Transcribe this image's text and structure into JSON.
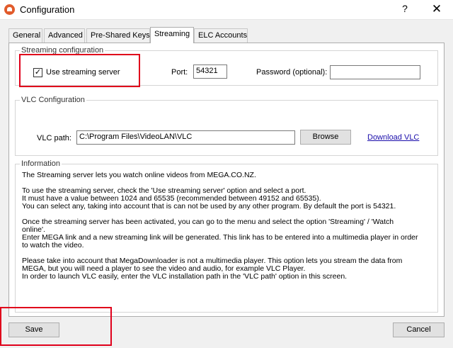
{
  "window": {
    "title": "Configuration",
    "help_glyph": "?",
    "close_glyph": "✕"
  },
  "tabs": [
    {
      "label": "General"
    },
    {
      "label": "Advanced"
    },
    {
      "label": "Pre-Shared Keys"
    },
    {
      "label": "Streaming",
      "active": true
    },
    {
      "label": "ELC Accounts"
    }
  ],
  "streaming": {
    "legend": "Streaming configuration",
    "use_server_label": "Use streaming server",
    "use_server_checked": true,
    "checkmark": "✓",
    "port_label": "Port:",
    "port_value": "54321",
    "password_label": "Password (optional):",
    "password_value": ""
  },
  "vlc": {
    "legend": "VLC Configuration",
    "path_label": "VLC path:",
    "path_value": "C:\\Program Files\\VideoLAN\\VLC",
    "browse_label": "Browse",
    "download_link": "Download VLC"
  },
  "information": {
    "legend": "Information",
    "lines": [
      "The Streaming server lets you watch online videos from MEGA.CO.NZ.",
      "",
      "To use the streaming server, check the 'Use streaming server' option and select a port.",
      "It must have a value between 1024 and 65535 (recommended between 49152 and 65535).",
      "You can select any, taking into account that is can not be used by any other program. By default the port is 54321.",
      "",
      "Once the streaming server has been activated, you can go to the menu and select the option 'Streaming' / 'Watch",
      "online'.",
      "Enter MEGA link and a new streaming link will be generated. This link has to be entered into a multimedia player in order",
      "to watch the video.",
      "",
      "Please take into account that MegaDownloader is not a multimedia player. This option lets you stream the data from",
      "MEGA, but you will need a player to see the video and audio, for example VLC Player.",
      "In order to launch VLC easily, enter the VLC installation path in the 'VLC path' option in this screen."
    ]
  },
  "footer": {
    "save_label": "Save",
    "cancel_label": "Cancel"
  },
  "colors": {
    "highlight": "#e0001b",
    "link": "#1a0dab"
  }
}
